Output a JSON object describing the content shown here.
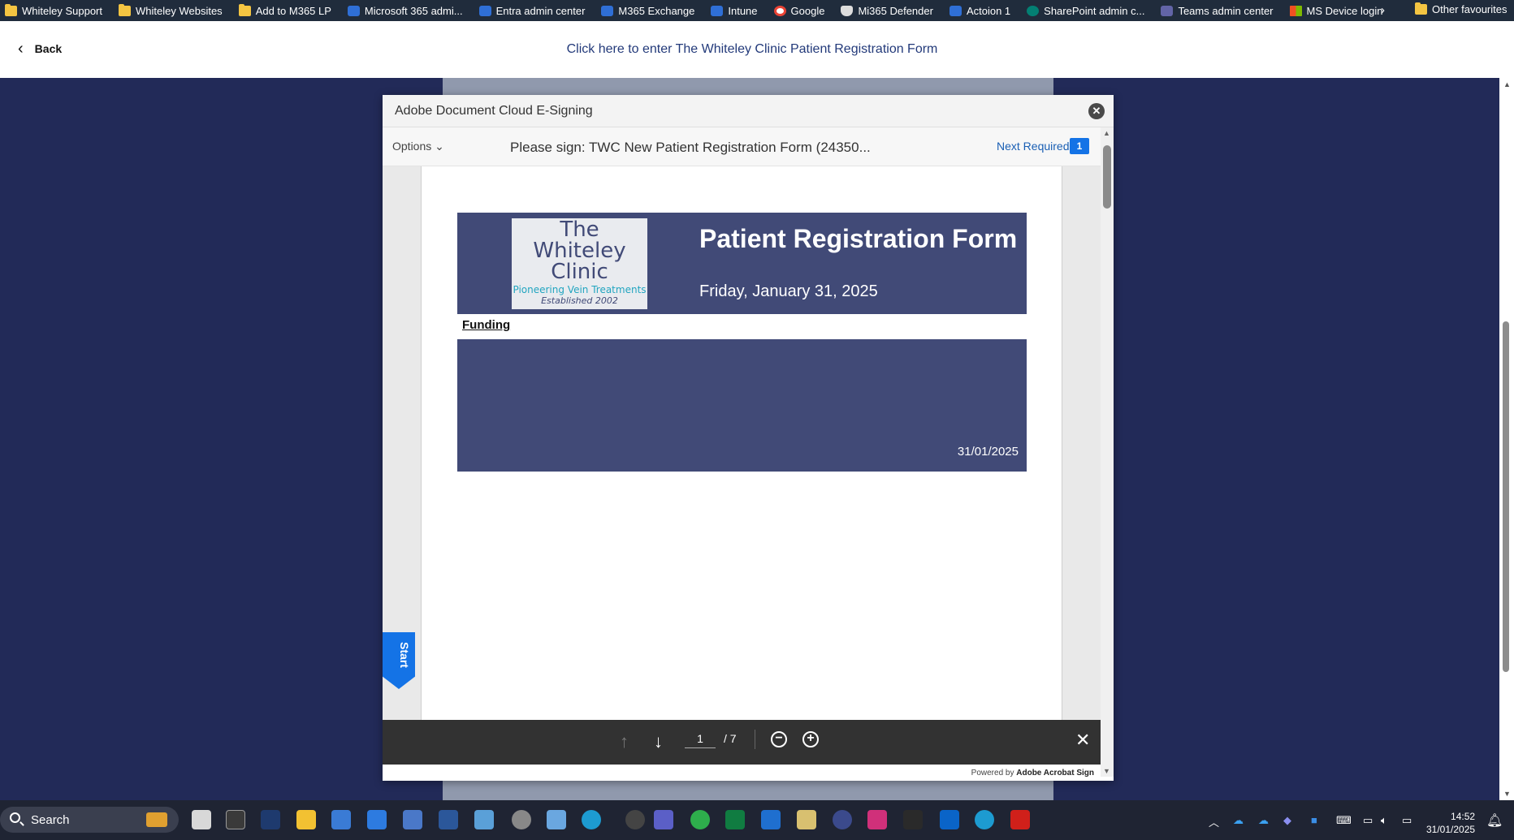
{
  "bookmarks": {
    "items": [
      {
        "label": "Whiteley Support",
        "icon": "folder-icon"
      },
      {
        "label": "Whiteley Websites",
        "icon": "folder-icon"
      },
      {
        "label": "Add to M365 LP",
        "icon": "folder-icon"
      },
      {
        "label": "Microsoft 365 admi...",
        "icon": "app-icon"
      },
      {
        "label": "Entra admin center",
        "icon": "entra-icon"
      },
      {
        "label": "M365 Exchange",
        "icon": "exchange-icon"
      },
      {
        "label": "Intune",
        "icon": "intune-icon"
      },
      {
        "label": "Google",
        "icon": "google-icon"
      },
      {
        "label": "Mi365 Defender",
        "icon": "shield-icon"
      },
      {
        "label": "Actoion 1",
        "icon": "app-icon"
      },
      {
        "label": "SharePoint admin c...",
        "icon": "sharepoint-icon"
      },
      {
        "label": "Teams admin center",
        "icon": "teams-icon"
      },
      {
        "label": "MS Device login",
        "icon": "microsoft-icon"
      }
    ],
    "other": "Other favourites"
  },
  "topbar": {
    "back_label": "Back",
    "link_text": "Click here to enter The Whiteley Clinic Patient Registration Form"
  },
  "modal": {
    "title": "Adobe Document Cloud E-Signing",
    "options_label": "Options",
    "doc_title": "Please sign: TWC New Patient Registration Form (24350...",
    "next_required_label": "Next Required",
    "next_required_count": "1",
    "start_label": "Start",
    "powered_prefix": "Powered by",
    "powered_brand": "Adobe Acrobat Sign"
  },
  "document": {
    "logo": {
      "line1": "The",
      "line2": "Whiteley",
      "line3": "Clinic",
      "tagline": "Pioneering Vein Treatments",
      "established": "Established 2002"
    },
    "form_title": "Patient Registration Form",
    "form_date": "Friday, January 31, 2025",
    "funding_label": "Funding",
    "funding_date": "31/01/2025"
  },
  "navigation": {
    "current_page": "1",
    "total_pages": "/ 7"
  },
  "taskbar": {
    "search_label": "Search",
    "time": "14:52",
    "date": "31/01/2025"
  },
  "colors": {
    "header_band": "#414a77",
    "page_background": "#222a58",
    "accent": "#1473e6"
  }
}
